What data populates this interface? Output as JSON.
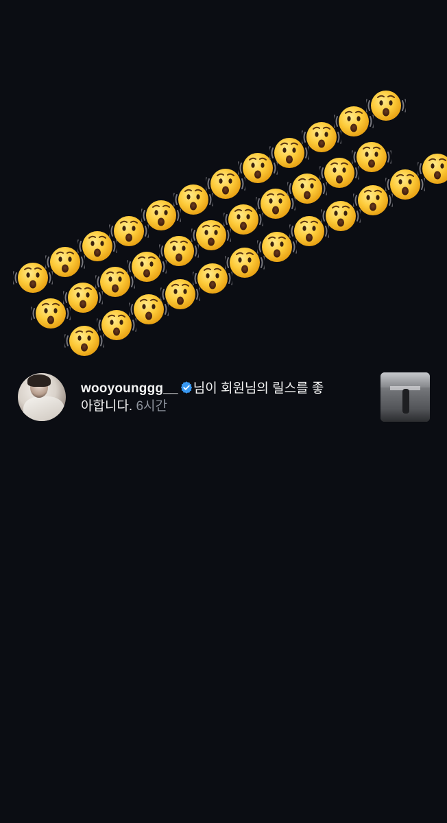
{
  "reaction": {
    "emoji_icon": "hushed-face-icon",
    "count": 35
  },
  "notification": {
    "username": "wooyounggg__",
    "verified_icon": "verified-badge-icon",
    "message_line1": "님이 회원님의 릴스를 좋",
    "message_line2": "아합니다.",
    "time": "6시간",
    "avatar_icon": "profile-avatar",
    "thumbnail_icon": "reel-thumbnail",
    "accent_color": "#3897f0",
    "time_color": "#8e939c",
    "background_color": "#0b0d13"
  }
}
